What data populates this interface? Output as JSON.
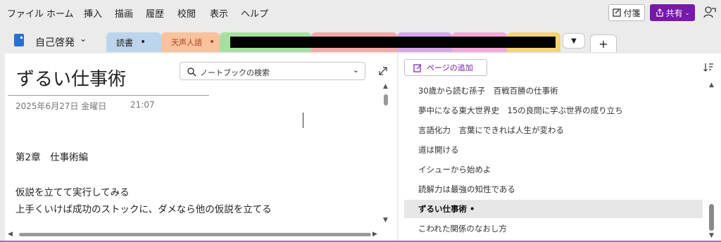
{
  "menu": {
    "items": [
      "ファイル",
      "ホーム",
      "挿入",
      "描画",
      "履歴",
      "校閲",
      "表示",
      "ヘルプ"
    ],
    "sticky_label": "付箋",
    "share_label": "共有"
  },
  "notebook": {
    "name": "自己啓発"
  },
  "tabs": [
    {
      "label": "読書",
      "dot": "•",
      "color": "#bcd5ec"
    },
    {
      "label": "天声人語",
      "dot": "•",
      "color": "#f7c29c"
    },
    {
      "label": "",
      "color": "#a5e0a1"
    },
    {
      "label": "",
      "color": "#f4a9a9"
    },
    {
      "label": "",
      "color": "#d6a6e6"
    },
    {
      "label": "",
      "color": "#f2a9d7"
    },
    {
      "label": "",
      "color": "#f4d56e"
    }
  ],
  "note": {
    "title": "ずるい仕事術",
    "date": "2025年6月27日 金曜日",
    "time": "21:07",
    "lines": [
      "第2章　仕事術編",
      "仮説を立てて実行してみる",
      "上手くいけば成功のストックに、ダメなら他の仮説を立てる"
    ]
  },
  "search": {
    "placeholder": "ノートブックの検索"
  },
  "pages": {
    "add_label": "ページの追加",
    "items": [
      "30歳から読む孫子　百戦百勝の仕事術",
      "夢中になる東大世界史　15の良問に学ぶ世界の成り立ち",
      "言語化力　言葉にできれば人生が変わる",
      "道は開ける",
      "イシューから始めよ",
      "読解力は最強の知性である",
      "ずるい仕事術 •",
      "こわれた関係のなおし方"
    ],
    "selected_index": 6
  },
  "colors": {
    "accent": "#7719aa",
    "notebook_icon": "#2a6fd6"
  }
}
